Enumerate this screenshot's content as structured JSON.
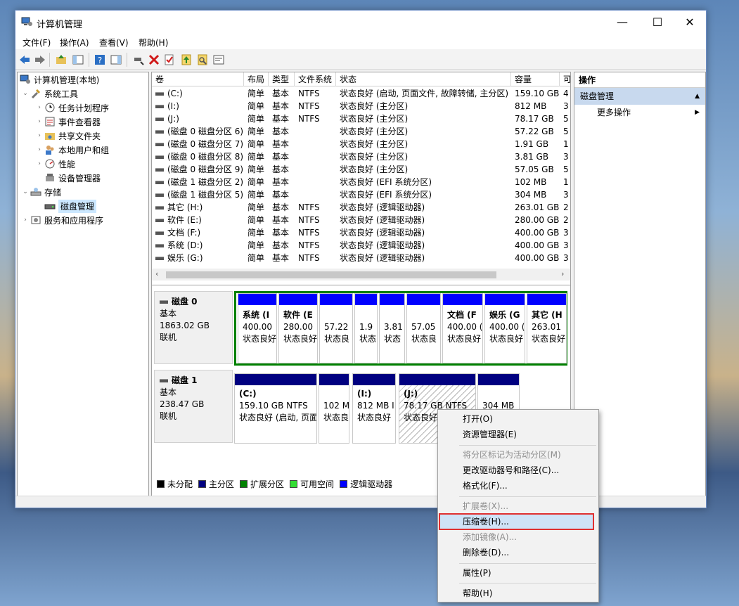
{
  "window": {
    "title": "计算机管理"
  },
  "titlebar": {
    "minimize": "—",
    "maximize": "☐",
    "close": "✕"
  },
  "menu": [
    "文件(F)",
    "操作(A)",
    "查看(V)",
    "帮助(H)"
  ],
  "tree": [
    {
      "label": "计算机管理(本地)",
      "level": 0,
      "arrow": ""
    },
    {
      "label": "系统工具",
      "level": 1,
      "arrow": "⌄"
    },
    {
      "label": "任务计划程序",
      "level": 2,
      "arrow": "›"
    },
    {
      "label": "事件查看器",
      "level": 2,
      "arrow": "›"
    },
    {
      "label": "共享文件夹",
      "level": 2,
      "arrow": "›"
    },
    {
      "label": "本地用户和组",
      "level": 2,
      "arrow": "›"
    },
    {
      "label": "性能",
      "level": 2,
      "arrow": "›"
    },
    {
      "label": "设备管理器",
      "level": 2,
      "arrow": ""
    },
    {
      "label": "存储",
      "level": 1,
      "arrow": "⌄"
    },
    {
      "label": "磁盘管理",
      "level": 2,
      "arrow": "",
      "selected": true
    },
    {
      "label": "服务和应用程序",
      "level": 1,
      "arrow": "›"
    }
  ],
  "volume_table": {
    "columns": [
      "卷",
      "布局",
      "类型",
      "文件系统",
      "状态",
      "容量",
      "可"
    ],
    "rows": [
      [
        "(C:)",
        "简单",
        "基本",
        "NTFS",
        "状态良好 (启动, 页面文件, 故障转储, 主分区)",
        "159.10 GB",
        "4"
      ],
      [
        "(I:)",
        "简单",
        "基本",
        "NTFS",
        "状态良好 (主分区)",
        "812 MB",
        "3"
      ],
      [
        "(J:)",
        "简单",
        "基本",
        "NTFS",
        "状态良好 (主分区)",
        "78.17 GB",
        "5"
      ],
      [
        "(磁盘 0 磁盘分区 6)",
        "简单",
        "基本",
        "",
        "状态良好 (主分区)",
        "57.22 GB",
        "5"
      ],
      [
        "(磁盘 0 磁盘分区 7)",
        "简单",
        "基本",
        "",
        "状态良好 (主分区)",
        "1.91 GB",
        "1"
      ],
      [
        "(磁盘 0 磁盘分区 8)",
        "简单",
        "基本",
        "",
        "状态良好 (主分区)",
        "3.81 GB",
        "3"
      ],
      [
        "(磁盘 0 磁盘分区 9)",
        "简单",
        "基本",
        "",
        "状态良好 (主分区)",
        "57.05 GB",
        "5"
      ],
      [
        "(磁盘 1 磁盘分区 2)",
        "简单",
        "基本",
        "",
        "状态良好 (EFI 系统分区)",
        "102 MB",
        "1"
      ],
      [
        "(磁盘 1 磁盘分区 5)",
        "简单",
        "基本",
        "",
        "状态良好 (EFI 系统分区)",
        "304 MB",
        "3"
      ],
      [
        "其它 (H:)",
        "简单",
        "基本",
        "NTFS",
        "状态良好 (逻辑驱动器)",
        "263.01 GB",
        "2"
      ],
      [
        "软件 (E:)",
        "简单",
        "基本",
        "NTFS",
        "状态良好 (逻辑驱动器)",
        "280.00 GB",
        "2"
      ],
      [
        "文档 (F:)",
        "简单",
        "基本",
        "NTFS",
        "状态良好 (逻辑驱动器)",
        "400.00 GB",
        "3"
      ],
      [
        "系统 (D:)",
        "简单",
        "基本",
        "NTFS",
        "状态良好 (逻辑驱动器)",
        "400.00 GB",
        "3"
      ],
      [
        "娱乐 (G:)",
        "简单",
        "基本",
        "NTFS",
        "状态良好 (逻辑驱动器)",
        "400.00 GB",
        "3"
      ]
    ]
  },
  "disk0": {
    "name": "磁盘 0",
    "type": "基本",
    "size": "1863.02 GB",
    "status": "联机",
    "partitions": [
      {
        "name": "系统 (I",
        "size": "400.00",
        "status": "状态良好"
      },
      {
        "name": "软件 (E",
        "size": "280.00",
        "status": "状态良好"
      },
      {
        "name": "",
        "size": "57.22",
        "status": "状态良"
      },
      {
        "name": "",
        "size": "1.9",
        "status": "状态"
      },
      {
        "name": "",
        "size": "3.81",
        "status": "状态"
      },
      {
        "name": "",
        "size": "57.05",
        "status": "状态良"
      },
      {
        "name": "文档 (F",
        "size": "400.00 (",
        "status": "状态良好"
      },
      {
        "name": "娱乐 (G",
        "size": "400.00 (",
        "status": "状态良好"
      },
      {
        "name": "其它 (H",
        "size": "263.01",
        "status": "状态良好"
      }
    ]
  },
  "disk1": {
    "name": "磁盘 1",
    "type": "基本",
    "size": "238.47 GB",
    "status": "联机",
    "partitions": [
      {
        "name": "(C:)",
        "size": "159.10 GB NTFS",
        "status": "状态良好 (启动, 页面"
      },
      {
        "name": "",
        "size": "102 M",
        "status": "状态良"
      },
      {
        "name": "(I:)",
        "size": "812 MB I",
        "status": "状态良好"
      },
      {
        "name": "(J:)",
        "size": "78.17 GB NTFS",
        "status": "状态良好"
      },
      {
        "name": "",
        "size": "304 MB",
        "status": ""
      }
    ]
  },
  "legend": [
    {
      "label": "未分配",
      "color": "#000000"
    },
    {
      "label": "主分区",
      "color": "#000080"
    },
    {
      "label": "扩展分区",
      "color": "#008000"
    },
    {
      "label": "可用空间",
      "color": "#33dd33"
    },
    {
      "label": "逻辑驱动器",
      "color": "#0000ff"
    }
  ],
  "actions": {
    "header": "操作",
    "selected": "磁盘管理",
    "more": "更多操作"
  },
  "context_menu": [
    {
      "label": "打开(O)",
      "disabled": false
    },
    {
      "label": "资源管理器(E)",
      "disabled": false
    },
    {
      "label": "将分区标记为活动分区(M)",
      "disabled": true
    },
    {
      "label": "更改驱动器号和路径(C)...",
      "disabled": false
    },
    {
      "label": "格式化(F)...",
      "disabled": false
    },
    {
      "label": "扩展卷(X)...",
      "disabled": true
    },
    {
      "label": "压缩卷(H)...",
      "disabled": false,
      "highlighted": true
    },
    {
      "label": "添加镜像(A)...",
      "disabled": true
    },
    {
      "label": "删除卷(D)...",
      "disabled": false
    },
    {
      "label": "属性(P)",
      "disabled": false
    },
    {
      "label": "帮助(H)",
      "disabled": false
    }
  ]
}
